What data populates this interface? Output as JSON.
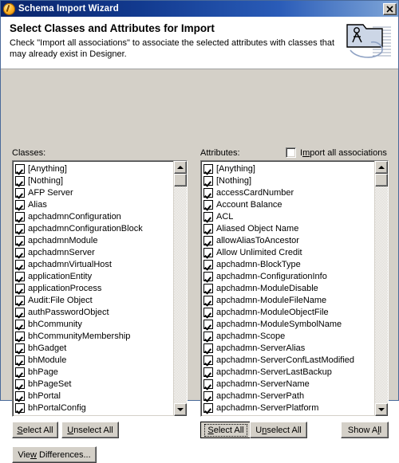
{
  "window": {
    "title": "Schema Import Wizard",
    "app_icon": "orb-icon",
    "close_label": "✖",
    "close_icon": "close-icon",
    "border_color": "#4a6a9a",
    "titlebar_gradient_start": "#0a246a",
    "titlebar_gradient_end": "#7fa6d8",
    "face_color": "#d4d0c8"
  },
  "header": {
    "title": "Select Classes and Attributes for Import",
    "description": "Check \"Import all associations\" to associate the selected attributes with classes that may already exist in Designer.",
    "icon": "schema-folder-compass-icon"
  },
  "options": {
    "import_all_associations": {
      "label_prefix": "I",
      "label_mnemonic": "m",
      "label_suffix": "port all associations",
      "checked": false
    }
  },
  "classes_panel": {
    "label": "Classes:",
    "scroll_position": "top",
    "items": [
      {
        "label": "[Anything]",
        "checked": true
      },
      {
        "label": "[Nothing]",
        "checked": true
      },
      {
        "label": "AFP Server",
        "checked": true
      },
      {
        "label": "Alias",
        "checked": true
      },
      {
        "label": "apchadmnConfiguration",
        "checked": true
      },
      {
        "label": "apchadmnConfigurationBlock",
        "checked": true
      },
      {
        "label": "apchadmnModule",
        "checked": true
      },
      {
        "label": "apchadmnServer",
        "checked": true
      },
      {
        "label": "apchadmnVirtualHost",
        "checked": true
      },
      {
        "label": "applicationEntity",
        "checked": true
      },
      {
        "label": "applicationProcess",
        "checked": true
      },
      {
        "label": "Audit:File Object",
        "checked": true
      },
      {
        "label": "authPasswordObject",
        "checked": true
      },
      {
        "label": "bhCommunity",
        "checked": true
      },
      {
        "label": "bhCommunityMembership",
        "checked": true
      },
      {
        "label": "bhGadget",
        "checked": true
      },
      {
        "label": "bhModule",
        "checked": true
      },
      {
        "label": "bhPage",
        "checked": true
      },
      {
        "label": "bhPageSet",
        "checked": true
      },
      {
        "label": "bhPortal",
        "checked": true
      },
      {
        "label": "bhPortalConfig",
        "checked": true
      }
    ],
    "buttons": {
      "select_all": {
        "prefix": "",
        "mnemonic": "S",
        "suffix": "elect All",
        "focused": false
      },
      "unselect_all": {
        "prefix": "",
        "mnemonic": "U",
        "suffix": "nselect All",
        "focused": false
      }
    }
  },
  "attributes_panel": {
    "label": "Attributes:",
    "scroll_position": "top",
    "items": [
      {
        "label": "[Anything]",
        "checked": true
      },
      {
        "label": "[Nothing]",
        "checked": true
      },
      {
        "label": "accessCardNumber",
        "checked": true
      },
      {
        "label": "Account Balance",
        "checked": true
      },
      {
        "label": "ACL",
        "checked": true
      },
      {
        "label": "Aliased Object Name",
        "checked": true
      },
      {
        "label": "allowAliasToAncestor",
        "checked": true
      },
      {
        "label": "Allow Unlimited Credit",
        "checked": true
      },
      {
        "label": "apchadmn-BlockType",
        "checked": true
      },
      {
        "label": "apchadmn-ConfigurationInfo",
        "checked": true
      },
      {
        "label": "apchadmn-ModuleDisable",
        "checked": true
      },
      {
        "label": "apchadmn-ModuleFileName",
        "checked": true
      },
      {
        "label": "apchadmn-ModuleObjectFile",
        "checked": true
      },
      {
        "label": "apchadmn-ModuleSymbolName",
        "checked": true
      },
      {
        "label": "apchadmn-Scope",
        "checked": true
      },
      {
        "label": "apchadmn-ServerAlias",
        "checked": true
      },
      {
        "label": "apchadmn-ServerConfLastModified",
        "checked": true
      },
      {
        "label": "apchadmn-ServerLastBackup",
        "checked": true
      },
      {
        "label": "apchadmn-ServerName",
        "checked": true
      },
      {
        "label": "apchadmn-ServerPath",
        "checked": true
      },
      {
        "label": "apchadmn-ServerPlatform",
        "checked": true
      }
    ],
    "buttons": {
      "select_all": {
        "prefix": "",
        "mnemonic": "S",
        "suffix": "elect All",
        "focused": true
      },
      "unselect_all": {
        "prefix": "U",
        "mnemonic": "n",
        "suffix": "select All",
        "focused": false
      },
      "show_all": {
        "prefix": "Show A",
        "mnemonic": "l",
        "suffix": "l",
        "focused": false
      }
    }
  },
  "footer": {
    "view_differences": {
      "prefix": "Vie",
      "mnemonic": "w",
      "suffix": " Differences...",
      "focused": false
    }
  }
}
